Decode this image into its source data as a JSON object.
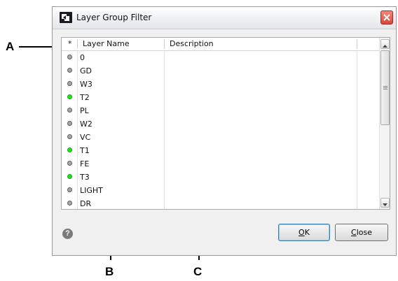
{
  "callouts": {
    "a": "A",
    "b": "B",
    "c": "C"
  },
  "dialog": {
    "title": "Layer Group Filter",
    "columns": {
      "star": "*",
      "name": "Layer Name",
      "description": "Description"
    },
    "rows": [
      {
        "name": "0",
        "status": "off"
      },
      {
        "name": "GD",
        "status": "off"
      },
      {
        "name": "W3",
        "status": "off"
      },
      {
        "name": "T2",
        "status": "on"
      },
      {
        "name": "PL",
        "status": "off"
      },
      {
        "name": "W2",
        "status": "off"
      },
      {
        "name": "VC",
        "status": "off"
      },
      {
        "name": "T1",
        "status": "on"
      },
      {
        "name": "FE",
        "status": "off"
      },
      {
        "name": "T3",
        "status": "on"
      },
      {
        "name": "LIGHT",
        "status": "off"
      },
      {
        "name": "DR",
        "status": "off"
      }
    ],
    "buttons": {
      "ok": {
        "mnemonic": "O",
        "rest": "K"
      },
      "close": {
        "mnemonic": "C",
        "rest": "lose"
      }
    },
    "help_icon_glyph": "?"
  },
  "colors": {
    "status_on": "#22e022",
    "status_off": "#a8a8a8"
  }
}
